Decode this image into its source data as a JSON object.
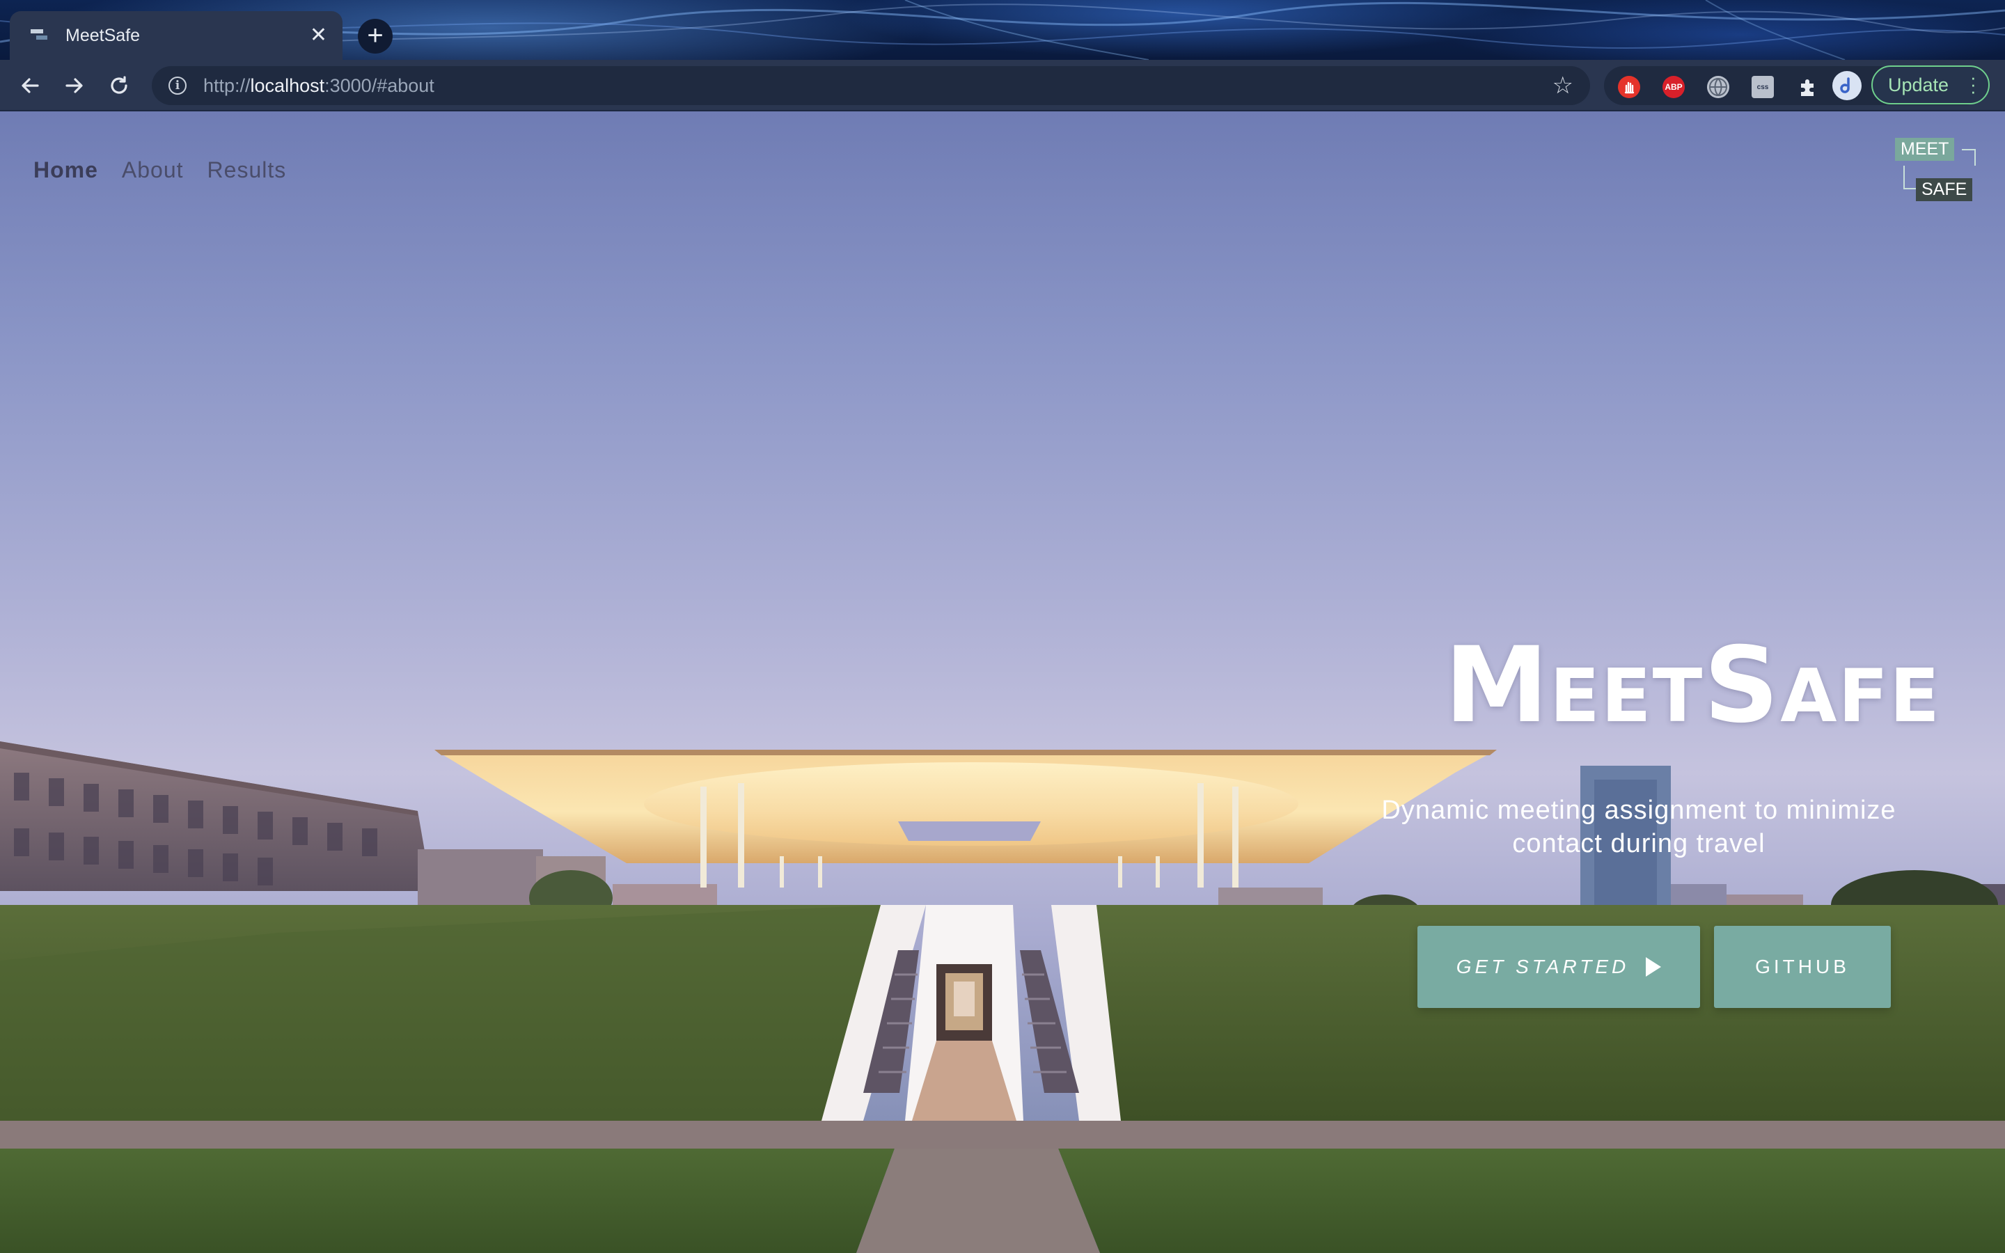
{
  "browser": {
    "tab": {
      "title": "MeetSafe",
      "close_glyph": "✕",
      "favicon": "meetsafe-favicon"
    },
    "new_tab_glyph": "+",
    "toolbar": {
      "back_icon": "arrow-left-icon",
      "forward_icon": "arrow-right-icon",
      "reload_icon": "reload-icon",
      "url_scheme": "http://",
      "url_host": "localhost",
      "url_rest": ":3000/#about",
      "bookmark_icon": "star-icon",
      "extensions": [
        {
          "name": "hand-stop-icon",
          "label": "",
          "color": "#e5332a"
        },
        {
          "name": "adblock-plus-icon",
          "label": "ABP",
          "color": "#d8202a"
        },
        {
          "name": "globe-icon",
          "label": "",
          "color": "#b9c0cc"
        },
        {
          "name": "css-viewer-icon",
          "label": "css",
          "color": "#b9c0cc"
        },
        {
          "name": "puzzle-extensions-icon",
          "label": "",
          "color": "#e8ecf2"
        },
        {
          "name": "profile-avatar-icon",
          "label": "",
          "color": "#d9e3f3"
        }
      ],
      "update_label": "Update",
      "menu_icon": "kebab-menu-icon"
    }
  },
  "site": {
    "nav": [
      {
        "label": "Home",
        "active": true
      },
      {
        "label": "About",
        "active": false
      },
      {
        "label": "Results",
        "active": false
      }
    ],
    "logo": {
      "top": "MEET",
      "bottom": "SAFE"
    },
    "hero": {
      "title": "MeetSafe",
      "subtitle_line1": "Dynamic meeting assignment to minimize",
      "subtitle_line2": "contact during travel",
      "primary_button": "GET STARTED",
      "secondary_button": "GITHUB"
    },
    "colors": {
      "accent": "#79aba2",
      "nav_text": "#4a4d6a"
    }
  }
}
